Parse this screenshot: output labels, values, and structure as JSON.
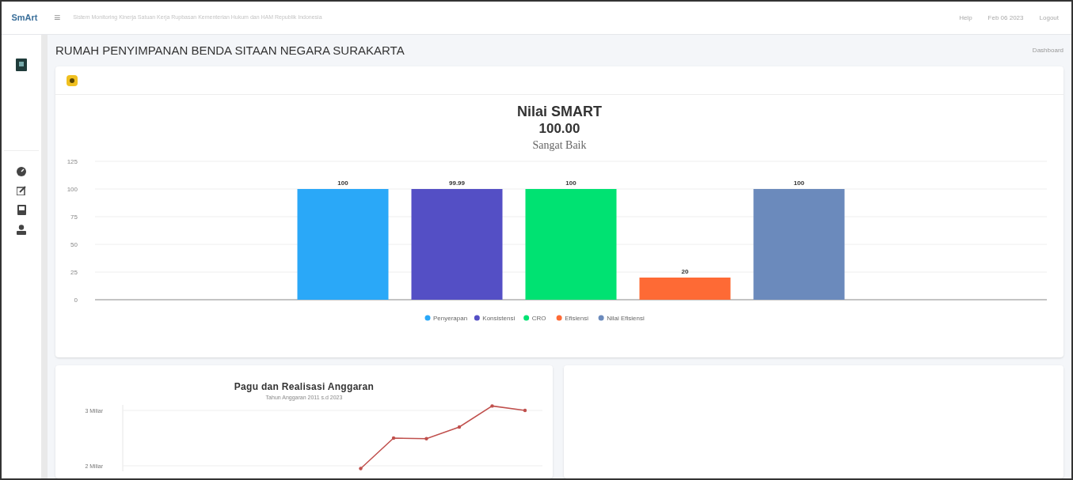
{
  "topbar": {
    "logo": "SmArt",
    "menu_icon": "≡",
    "subtitle": "Sistem Monitoring Kinerja Satuan Kerja Rupbasan Kementerian Hukum dan HAM Republik Indonesia",
    "links": [
      "Help",
      "Feb 06 2023",
      "Logout"
    ]
  },
  "page": {
    "title": "RUMAH PENYIMPANAN BENDA SITAAN NEGARA SURAKARTA",
    "breadcrumb": "Dashboard"
  },
  "smart_card": {
    "title": "Nilai SMART",
    "score": "100.00",
    "grade": "Sangat Baik",
    "chart_data": {
      "type": "bar",
      "series": [
        {
          "name": "Penyerapan",
          "color": "#2aa8f8",
          "values": [
            100
          ]
        },
        {
          "name": "Konsistensi",
          "color": "#544fc5",
          "values": [
            99.99
          ]
        },
        {
          "name": "CRO",
          "color": "#00e272",
          "values": [
            100
          ]
        },
        {
          "name": "Efisiensi",
          "color": "#fe6a35",
          "values": [
            20
          ]
        },
        {
          "name": "Nilai Efisiensi",
          "color": "#6b8abc",
          "values": [
            100
          ]
        }
      ],
      "ylim": [
        0,
        125
      ],
      "yticks": [
        0,
        25,
        50,
        75,
        100,
        125
      ],
      "grid": true,
      "legend": true,
      "data_labels": true
    }
  },
  "budget_card": {
    "chart_data": {
      "type": "line",
      "title": "Pagu dan Realisasi Anggaran",
      "subtitle": "Tahun Anggaran 2011 s.d 2023",
      "categories": [
        null,
        null,
        null,
        null,
        null,
        null,
        null,
        null,
        null,
        null,
        null,
        null,
        null
      ],
      "series": [
        {
          "color": "#c0504d",
          "values": [
            null,
            null,
            null,
            null,
            null,
            null,
            null,
            1.95,
            2.5,
            2.49,
            2.7,
            3.08,
            3.0
          ]
        }
      ],
      "ylim": [
        1.9,
        3.1
      ],
      "yticks": [
        {
          "value": 2,
          "label": "2 Miliar"
        },
        {
          "value": 3,
          "label": "3 Miliar"
        }
      ]
    }
  }
}
